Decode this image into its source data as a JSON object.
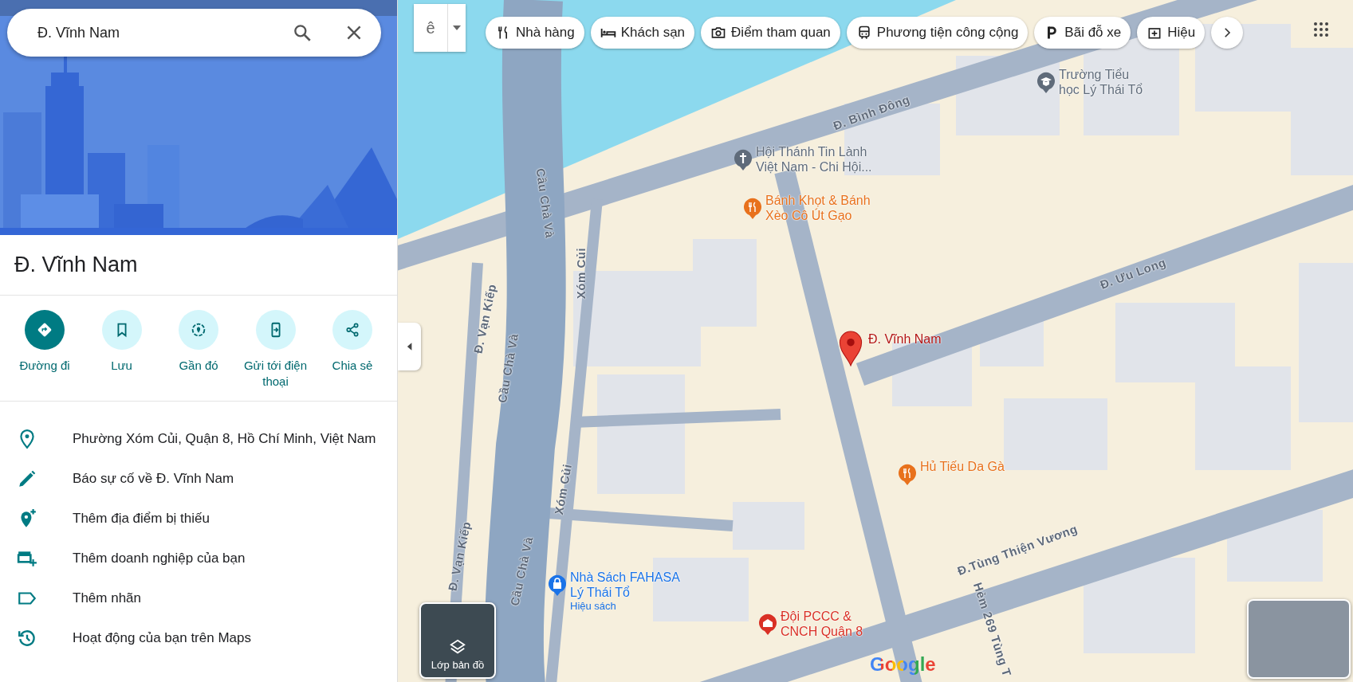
{
  "search": {
    "value": "Đ. Vĩnh Nam"
  },
  "place": {
    "title": "Đ. Vĩnh Nam"
  },
  "actions": [
    {
      "label": "Đường đi",
      "kind": "directions",
      "primary": true
    },
    {
      "label": "Lưu",
      "kind": "save",
      "primary": false
    },
    {
      "label": "Gần đó",
      "kind": "nearby",
      "primary": false
    },
    {
      "label": "Gửi tới điện thoại",
      "kind": "phone",
      "primary": false
    },
    {
      "label": "Chia sẻ",
      "kind": "share",
      "primary": false
    }
  ],
  "info_items": [
    {
      "kind": "address",
      "text": "Phường Xóm Củi, Quận 8, Hồ Chí Minh, Việt Nam"
    },
    {
      "kind": "edit",
      "text": "Báo sự cố về Đ. Vĩnh Nam"
    },
    {
      "kind": "add_place",
      "text": "Thêm địa điểm bị thiếu"
    },
    {
      "kind": "add_business",
      "text": "Thêm doanh nghiệp của bạn"
    },
    {
      "kind": "label",
      "text": "Thêm nhãn"
    },
    {
      "kind": "history",
      "text": "Hoạt động của bạn trên Maps"
    }
  ],
  "map_type": {
    "label": "ê"
  },
  "categories": [
    {
      "kind": "restaurant",
      "label": "Nhà hàng"
    },
    {
      "kind": "hotel",
      "label": "Khách sạn"
    },
    {
      "kind": "attraction",
      "label": "Điểm tham quan"
    },
    {
      "kind": "transit",
      "label": "Phương tiện công cộng"
    },
    {
      "kind": "parking",
      "label": "Bãi đỗ xe"
    },
    {
      "kind": "pharmacy",
      "label": "Hiệu"
    }
  ],
  "map": {
    "roads": [
      {
        "text": "Đ. Bình Đông"
      },
      {
        "text": "Cầu Chà Và"
      },
      {
        "text": "Xóm Củi"
      },
      {
        "text": "Đ. Ưu Long"
      },
      {
        "text": "Đ. Vạn Kiếp"
      },
      {
        "text": "Cầu Chà Và"
      },
      {
        "text": "Xóm Củi"
      },
      {
        "text": "Đ.Tùng Thiện Vương"
      },
      {
        "text": "Đ. Vạn Kiếp"
      },
      {
        "text": "Cầu Chà Và"
      },
      {
        "text": "Hẻm 269 Tùng T"
      }
    ],
    "places": [
      {
        "kind": "school",
        "color": "#5f6b7a",
        "lines": [
          "Trường Tiểu",
          "học Lý Thái Tổ"
        ]
      },
      {
        "kind": "church",
        "color": "#5f6b7a",
        "lines": [
          "Hội Thánh Tin Lành",
          "Việt Nam - Chi Hội..."
        ]
      },
      {
        "kind": "restaurant",
        "color": "#e8711c",
        "lines": [
          "Bánh Khọt & Bánh",
          "Xèo Cô Út Gạo"
        ]
      },
      {
        "kind": "restaurant",
        "color": "#e8711c",
        "lines": [
          "Hủ Tiếu Da Gà"
        ]
      },
      {
        "kind": "shop",
        "color": "#1a73e8",
        "lines": [
          "Nhà Sách FAHASA",
          "Lý Thái Tổ"
        ],
        "subtitle": "Hiệu sách"
      },
      {
        "kind": "fire_station",
        "color": "#d93025",
        "lines": [
          "Đội PCCC &",
          "CNCH Quận 8"
        ]
      }
    ],
    "pin": {
      "label": "Đ. Vĩnh Nam"
    },
    "layers": {
      "label": "Lớp bản đồ"
    },
    "attribution": "Google"
  }
}
